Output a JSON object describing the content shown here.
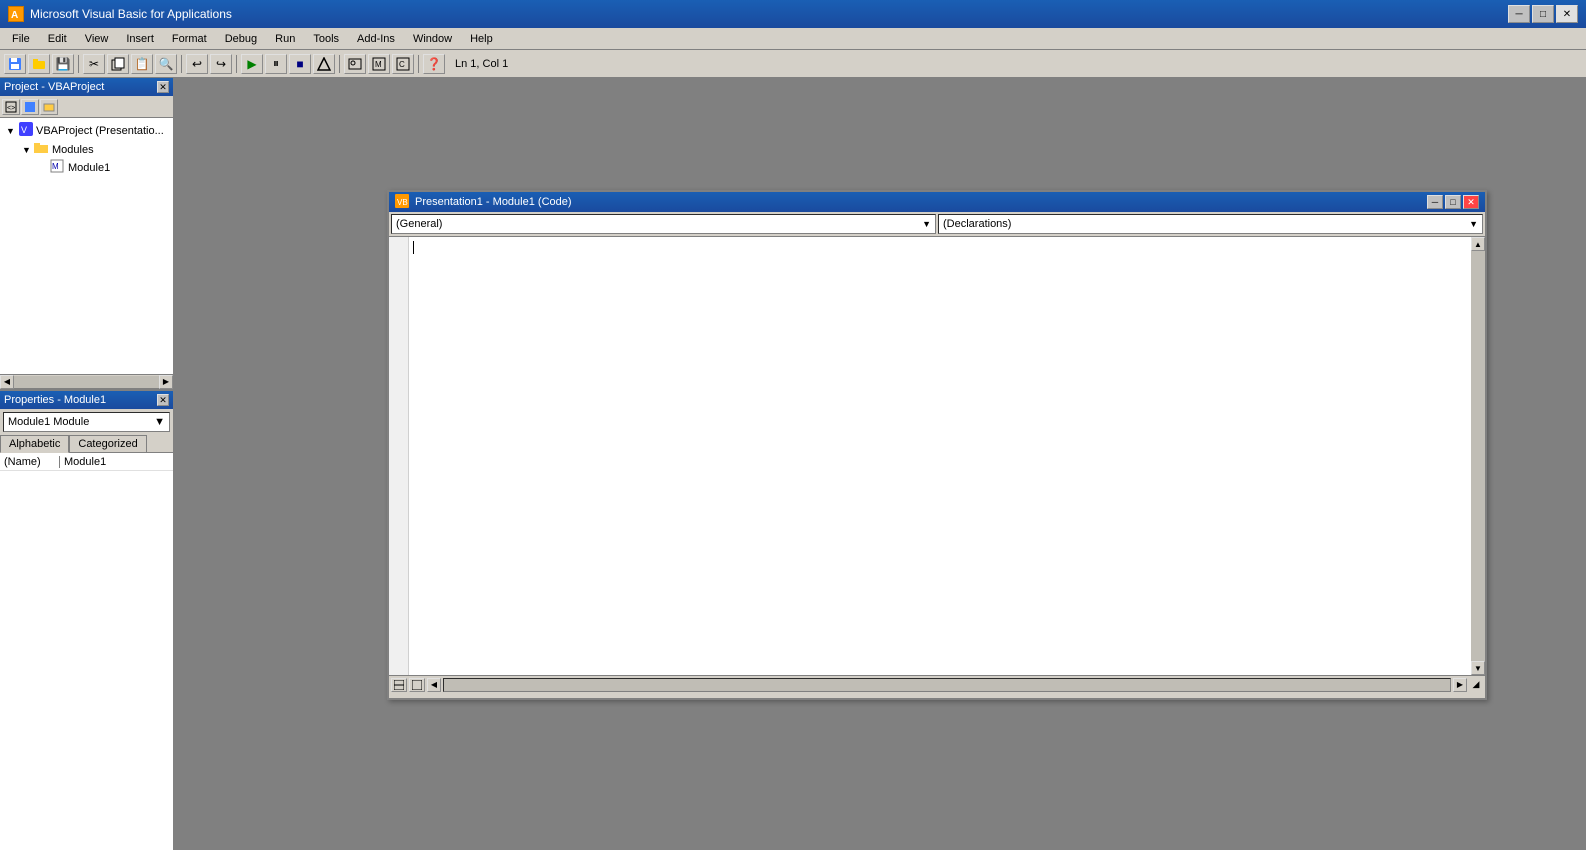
{
  "titleBar": {
    "appName": "Microsoft Visual Basic for Applications",
    "minimize": "─",
    "maximize": "□",
    "close": "✕"
  },
  "menuBar": {
    "items": [
      "File",
      "Edit",
      "View",
      "Insert",
      "Format",
      "Debug",
      "Run",
      "Tools",
      "Add-Ins",
      "Window",
      "Help"
    ]
  },
  "toolbar": {
    "status": "Ln 1, Col 1"
  },
  "projectPanel": {
    "title": "Project - VBAProject",
    "rootItem": "VBAProject (Presentatio...",
    "modules": "Modules",
    "module1": "Module1"
  },
  "propertiesPanel": {
    "title": "Properties - Module1",
    "dropdownValue": "Module1  Module",
    "tabs": {
      "alphabetic": "Alphabetic",
      "categorized": "Categorized"
    },
    "properties": [
      {
        "name": "(Name)",
        "value": "Module1"
      }
    ]
  },
  "codeWindow": {
    "title": "Presentation1 - Module1 (Code)",
    "generalDropdown": "(General)",
    "declarationsDropdown": "(Declarations)",
    "minimize": "─",
    "maximize": "□",
    "close": "✕"
  }
}
